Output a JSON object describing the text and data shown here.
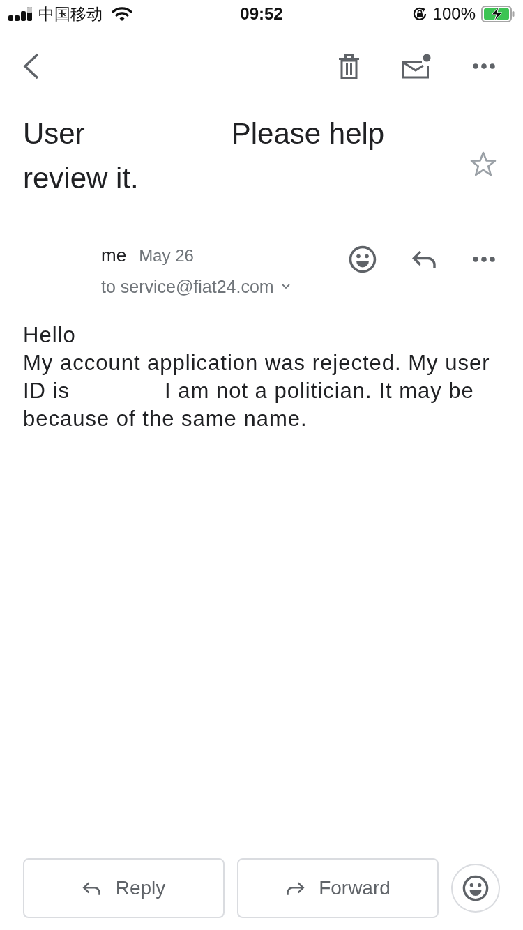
{
  "status_bar": {
    "carrier": "中国移动",
    "time": "09:52",
    "battery": "100%"
  },
  "subject": {
    "parts": [
      "User",
      "Please help review it."
    ],
    "starred": false
  },
  "message": {
    "sender": "me",
    "date": "May 26",
    "recipients": "to service@fiat24.com",
    "greeting": "Hello",
    "body": [
      "My account application was rejected. My user ID is",
      "I am not a politician. It may be because of the same name."
    ]
  },
  "actions": [
    {
      "kind": "reply",
      "label": "Reply"
    },
    {
      "kind": "forward",
      "label": "Forward"
    }
  ]
}
